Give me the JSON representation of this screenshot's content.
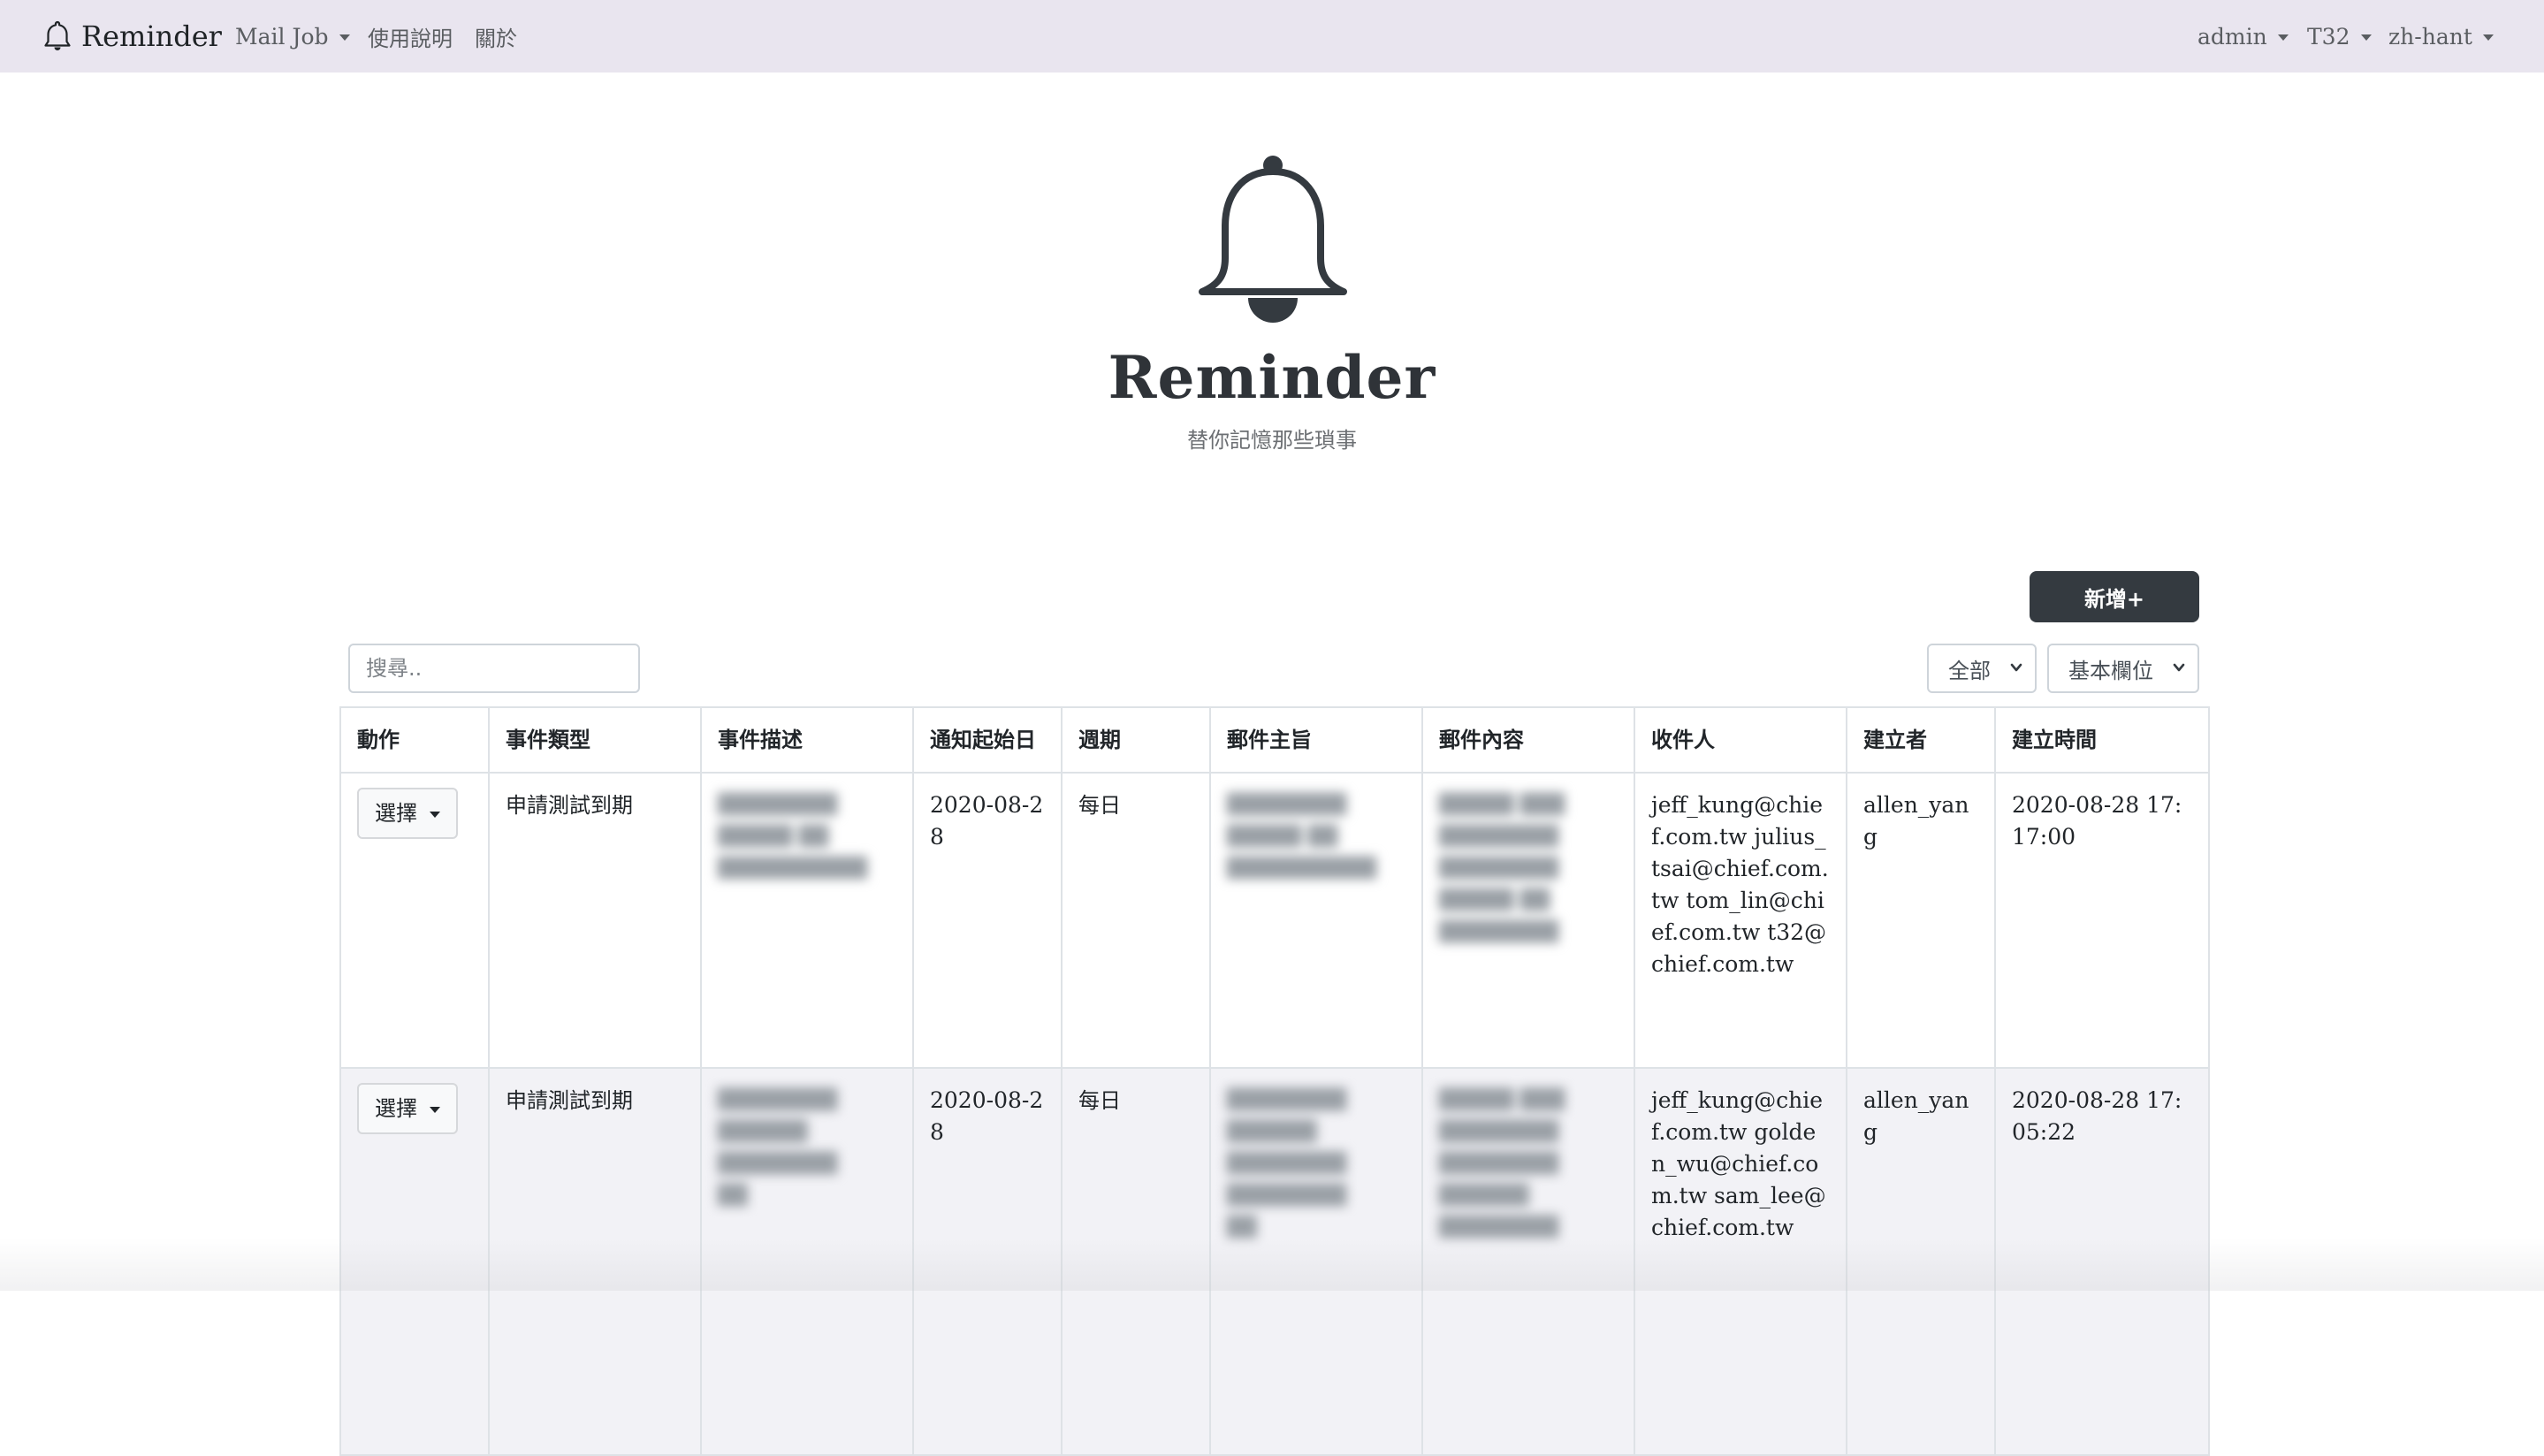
{
  "navbar": {
    "brand": "Reminder",
    "brand_icon": "bell-icon",
    "menu": {
      "mail_job": "Mail Job",
      "help": "使用說明",
      "about": "關於"
    },
    "right": {
      "user": "admin",
      "org": "T32",
      "lang": "zh-hant"
    },
    "background": "#e9e5ef"
  },
  "hero": {
    "icon": "bell-icon",
    "title": "Reminder",
    "subtitle": "替你記憶那些瑣事"
  },
  "toolbar": {
    "add_label": "新增+",
    "search_placeholder": "搜尋..",
    "filter_selected": "全部",
    "columns_selected": "基本欄位",
    "accent": "#343a40"
  },
  "table": {
    "headers": [
      "動作",
      "事件類型",
      "事件描述",
      "通知起始日",
      "週期",
      "郵件主旨",
      "郵件內容",
      "收件人",
      "建立者",
      "建立時間"
    ],
    "rows": [
      {
        "action": "選擇",
        "type": "申請測試到期",
        "description": "",
        "start_date": "2020-08-28",
        "period": "每日",
        "subject": "",
        "content": "",
        "recipients": "jeff_kung@chief.com.tw julius_tsai@chief.com.tw tom_lin@chief.com.tw t32@chief.com.tw",
        "creator": "allen_yang",
        "created_at": "2020-08-28 17:17:00"
      },
      {
        "action": "選擇",
        "type": "申請測試到期",
        "description": "",
        "start_date": "2020-08-28",
        "period": "每日",
        "subject": "",
        "content": "",
        "recipients": "jeff_kung@chief.com.tw golden_wu@chief.com.tw sam_lee@chief.com.tw",
        "creator": "allen_yang",
        "created_at": "2020-08-28 17:05:22"
      }
    ]
  }
}
